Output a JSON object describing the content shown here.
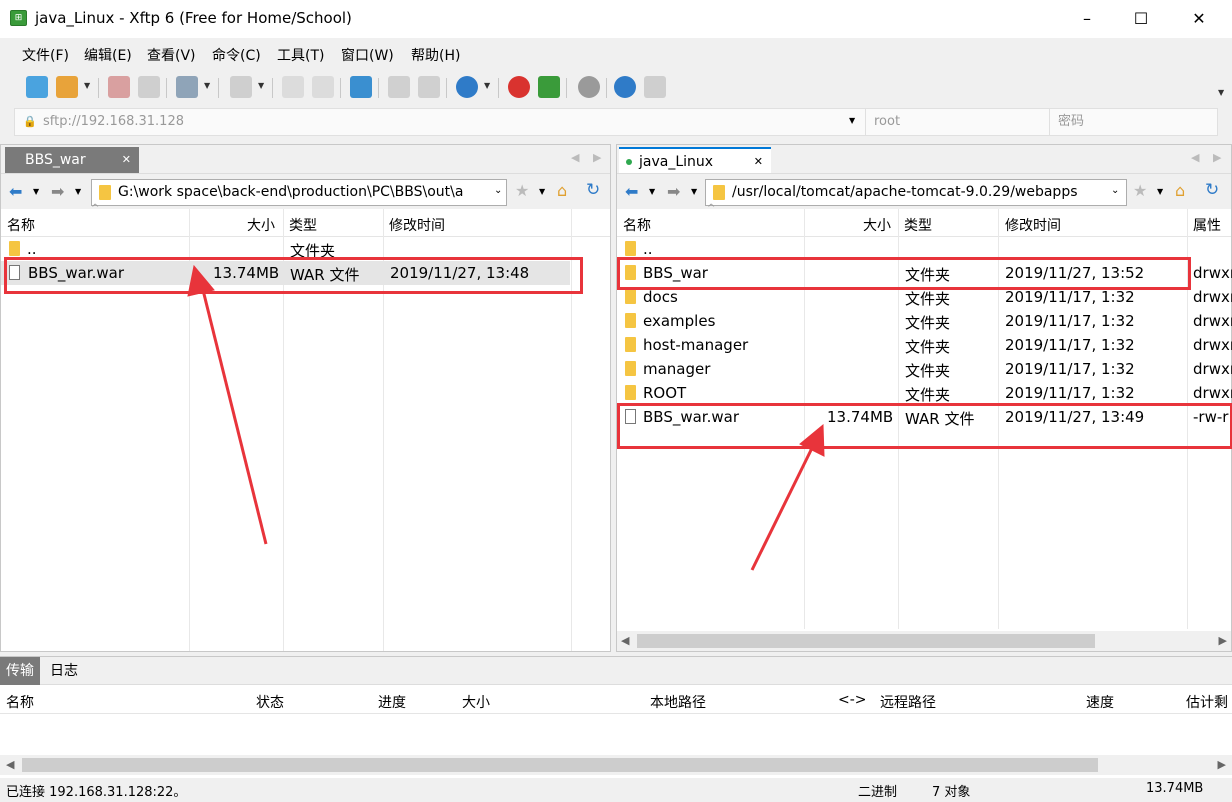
{
  "window": {
    "title": "java_Linux - Xftp 6 (Free for Home/School)"
  },
  "menu": [
    "文件(F)",
    "编辑(E)",
    "查看(V)",
    "命令(C)",
    "工具(T)",
    "窗口(W)",
    "帮助(H)"
  ],
  "address": {
    "host": "sftp://192.168.31.128",
    "user_placeholder": "root",
    "password_placeholder": "密码"
  },
  "left": {
    "tab": "BBS_war",
    "path": "G:\\work space\\back-end\\production\\PC\\BBS\\out\\a",
    "columns": {
      "name": "名称",
      "size": "大小",
      "type": "类型",
      "modified": "修改时间"
    },
    "rows": [
      {
        "name": "..",
        "size": "",
        "type": "文件夹",
        "modified": "",
        "icon": "folder-icon"
      },
      {
        "name": "BBS_war.war",
        "size": "13.74MB",
        "type": "WAR 文件",
        "modified": "2019/11/27, 13:48",
        "icon": "file-icon"
      }
    ]
  },
  "right": {
    "tab": "java_Linux",
    "path": "/usr/local/tomcat/apache-tomcat-9.0.29/webapps",
    "columns": {
      "name": "名称",
      "size": "大小",
      "type": "类型",
      "modified": "修改时间",
      "attr": "属性"
    },
    "rows": [
      {
        "name": "..",
        "size": "",
        "type": "",
        "modified": "",
        "attr": "",
        "icon": "folder-icon"
      },
      {
        "name": "BBS_war",
        "size": "",
        "type": "文件夹",
        "modified": "2019/11/27, 13:52",
        "attr": "drwxr",
        "icon": "folder-icon"
      },
      {
        "name": "docs",
        "size": "",
        "type": "文件夹",
        "modified": "2019/11/17, 1:32",
        "attr": "drwxr",
        "icon": "folder-icon"
      },
      {
        "name": "examples",
        "size": "",
        "type": "文件夹",
        "modified": "2019/11/17, 1:32",
        "attr": "drwxr",
        "icon": "folder-icon"
      },
      {
        "name": "host-manager",
        "size": "",
        "type": "文件夹",
        "modified": "2019/11/17, 1:32",
        "attr": "drwxr",
        "icon": "folder-icon"
      },
      {
        "name": "manager",
        "size": "",
        "type": "文件夹",
        "modified": "2019/11/17, 1:32",
        "attr": "drwxr",
        "icon": "folder-icon"
      },
      {
        "name": "ROOT",
        "size": "",
        "type": "文件夹",
        "modified": "2019/11/17, 1:32",
        "attr": "drwxr",
        "icon": "folder-icon"
      },
      {
        "name": "BBS_war.war",
        "size": "13.74MB",
        "type": "WAR 文件",
        "modified": "2019/11/27, 13:49",
        "attr": "-rw-r",
        "icon": "file-icon"
      }
    ]
  },
  "bottom": {
    "tabs": [
      "传输",
      "日志"
    ],
    "columns": [
      "名称",
      "状态",
      "进度",
      "大小",
      "本地路径",
      "<->",
      "远程路径",
      "速度",
      "估计剩"
    ]
  },
  "status": {
    "connection": "已连接 192.168.31.128:22。",
    "mode": "二进制",
    "count": "7 对象",
    "size": "13.74MB"
  },
  "colors": {
    "annotation": "#e8343b",
    "accent": "#0078d7",
    "folder": "#f5c542"
  }
}
